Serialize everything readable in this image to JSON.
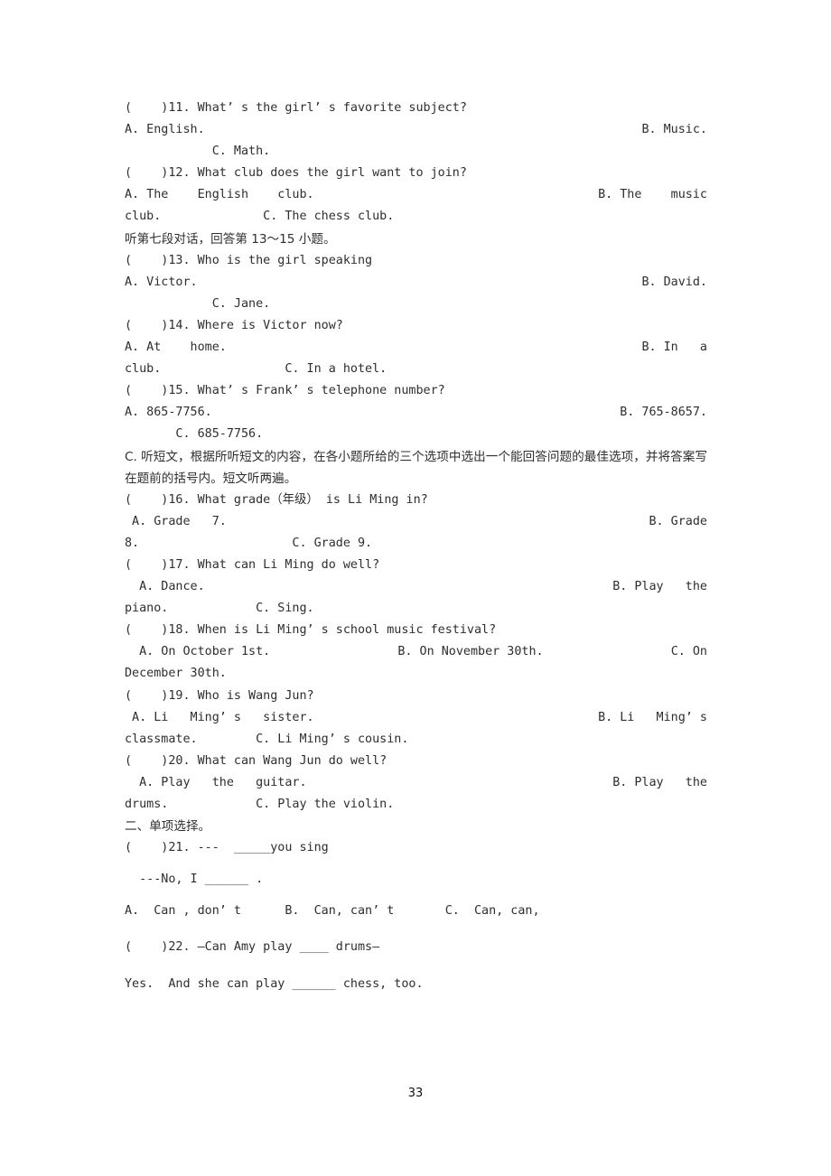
{
  "page": {
    "number": "33"
  },
  "lines": [
    {
      "id": "q11",
      "type": "plain",
      "text": "(    )11. What’ s the girl’ s favorite subject?"
    },
    {
      "id": "q11_ab",
      "type": "just2",
      "left": "A. English.",
      "right": "B. Music."
    },
    {
      "id": "q11_c",
      "type": "plain",
      "text": "            C. Math."
    },
    {
      "id": "q12",
      "type": "plain",
      "text": "(    )12. What club does the girl want to join?"
    },
    {
      "id": "q12_ab",
      "type": "just2",
      "left": "A. The    English    club.",
      "right": "B. The    music"
    },
    {
      "id": "q12_c",
      "type": "plain",
      "text": "club.              C. The chess club."
    },
    {
      "id": "cn_dialog7",
      "type": "cn",
      "text": "听第七段对话，回答第 13～15 小题。"
    },
    {
      "id": "q13",
      "type": "plain",
      "text": "(    )13. Who is the girl speaking"
    },
    {
      "id": "q13_ab",
      "type": "just2",
      "left": "A. Victor.",
      "right": "B. David."
    },
    {
      "id": "q13_c",
      "type": "plain",
      "text": "            C. Jane."
    },
    {
      "id": "q14",
      "type": "plain",
      "text": "(    )14. Where is Victor now?"
    },
    {
      "id": "q14_ab",
      "type": "just2",
      "left": "A. At    home.",
      "right": "B. In   a"
    },
    {
      "id": "q14_c",
      "type": "plain",
      "text": "club.                 C. In a hotel."
    },
    {
      "id": "q15",
      "type": "plain",
      "text": "(    )15. What’ s Frank’ s telephone number?"
    },
    {
      "id": "q15_ab",
      "type": "just2",
      "left": "A. 865-7756.",
      "right": "B. 765-8657."
    },
    {
      "id": "q15_c",
      "type": "plain",
      "text": "       C. 685-7756."
    },
    {
      "id": "cn_partC",
      "type": "cn-para",
      "text": "C. 听短文，根据所听短文的内容，在各小题所给的三个选项中选出一个能回答问题的最佳选项，并将答案写在题前的括号内。短文听两遍。"
    },
    {
      "id": "q16",
      "type": "mixed",
      "pre": "(    )16. What grade（",
      "han": "年级",
      "post": "） is Li Ming in?"
    },
    {
      "id": "q16_ab",
      "type": "just2",
      "left": " A. Grade   7.",
      "right": "B. Grade"
    },
    {
      "id": "q16_c",
      "type": "plain",
      "text": "8.                     C. Grade 9."
    },
    {
      "id": "q17",
      "type": "plain",
      "text": "(    )17. What can Li Ming do well?"
    },
    {
      "id": "q17_ab",
      "type": "just2",
      "left": "  A. Dance.",
      "right": "B. Play   the"
    },
    {
      "id": "q17_c",
      "type": "plain",
      "text": "piano.            C. Sing."
    },
    {
      "id": "q18",
      "type": "plain",
      "text": "(    )18. When is Li Ming’ s school music festival?"
    },
    {
      "id": "q18_abc",
      "type": "just3",
      "left": "  A. On October 1st.",
      "mid": "B. On November 30th.",
      "right": "C. On"
    },
    {
      "id": "q18_c2",
      "type": "plain",
      "text": "December 30th."
    },
    {
      "id": "q19",
      "type": "plain",
      "text": "(    )19. Who is Wang Jun?"
    },
    {
      "id": "q19_ab",
      "type": "just2",
      "left": " A. Li   Ming’ s   sister.",
      "right": "B. Li   Ming’ s"
    },
    {
      "id": "q19_c",
      "type": "plain",
      "text": "classmate.        C. Li Ming’ s cousin."
    },
    {
      "id": "q20",
      "type": "plain",
      "text": "(    )20. What can Wang Jun do well?"
    },
    {
      "id": "q20_ab",
      "type": "just2",
      "left": "  A. Play   the   guitar.",
      "right": "B. Play   the"
    },
    {
      "id": "q20_c",
      "type": "plain",
      "text": "drums.            C. Play the violin."
    },
    {
      "id": "cn_section2",
      "type": "cn",
      "text": "二、单项选择。"
    },
    {
      "id": "q21",
      "type": "plain",
      "text": "(    )21. ---  _____you sing"
    },
    {
      "id": "q21_b",
      "type": "plain",
      "text": "  ---No, I ______ ."
    },
    {
      "id": "q21_opts",
      "type": "plain",
      "text": "A.  Can , don’ t      B.  Can, can’ t       C.  Can, can,"
    },
    {
      "id": "q22",
      "type": "plain",
      "text": "(    )22. —Can Amy play ____ drums—"
    },
    {
      "id": "q22_b",
      "type": "plain",
      "text": "Yes.  And she can play ______ chess, too."
    }
  ]
}
